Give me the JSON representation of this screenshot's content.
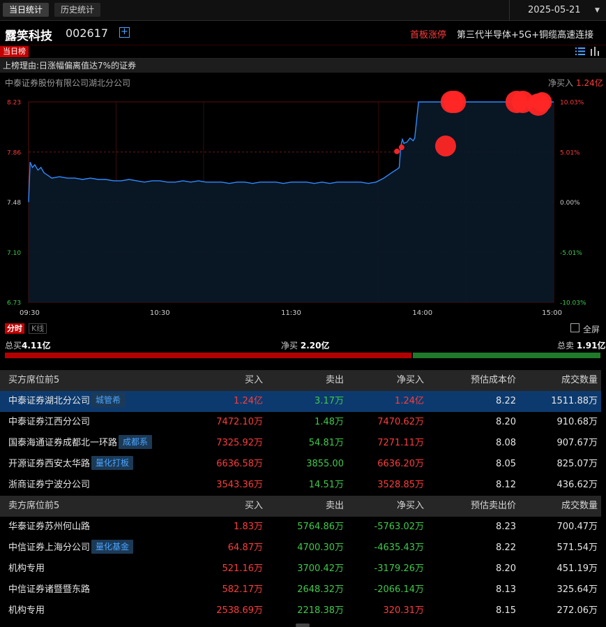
{
  "tabs": {
    "today": "当日统计",
    "history": "历史统计"
  },
  "date": "2025-05-21",
  "stock": {
    "name": "露笑科技",
    "code": "002617",
    "add_symbol": "+",
    "first_limit": "首板涨停",
    "concept": "第三代半导体+5G+铜缆高速连接"
  },
  "list": {
    "badge": "当日榜",
    "reason": "上榜理由:日涨幅偏离值达7%的证券",
    "broker": "中泰证券股份有限公司湖北分公司",
    "net_buy_label": "净买入",
    "net_buy_value": "1.24亿"
  },
  "chart_data": {
    "type": "line",
    "y_left_ticks": [
      "8.23",
      "7.86",
      "7.48",
      "7.10",
      "6.73"
    ],
    "y_right_ticks": [
      "10.03%",
      "5.01%",
      "0.00%",
      "-5.01%",
      "-10.03%"
    ],
    "x_ticks": [
      "09:30",
      "10:30",
      "11:30",
      "14:00",
      "15:00"
    ],
    "ylim": [
      6.73,
      8.23
    ],
    "prev_close": 7.48,
    "x_minutes": [
      0,
      2,
      5,
      8,
      12,
      16,
      20,
      25,
      30,
      40,
      50,
      60,
      70,
      80,
      90,
      100,
      110,
      120,
      130,
      140,
      150,
      160,
      170,
      180,
      190,
      200,
      210,
      220,
      230,
      240,
      250,
      260,
      270,
      280,
      290,
      300,
      310,
      320,
      330,
      340,
      350,
      360,
      370,
      380,
      390,
      400,
      410,
      420,
      430,
      440,
      450,
      460,
      470,
      478,
      480,
      482,
      484,
      486,
      490,
      494,
      498,
      500,
      505,
      510,
      520,
      530,
      540,
      550,
      560,
      570,
      580,
      590,
      600,
      610,
      620,
      630,
      640,
      650,
      660,
      670,
      680
    ],
    "price": [
      7.48,
      7.78,
      7.74,
      7.76,
      7.72,
      7.74,
      7.7,
      7.68,
      7.66,
      7.67,
      7.66,
      7.66,
      7.65,
      7.66,
      7.65,
      7.65,
      7.64,
      7.64,
      7.65,
      7.64,
      7.63,
      7.64,
      7.64,
      7.63,
      7.63,
      7.64,
      7.63,
      7.64,
      7.63,
      7.63,
      7.63,
      7.62,
      7.63,
      7.63,
      7.62,
      7.63,
      7.63,
      7.63,
      7.62,
      7.63,
      7.63,
      7.63,
      7.62,
      7.63,
      7.62,
      7.63,
      7.63,
      7.63,
      7.63,
      7.62,
      7.63,
      7.66,
      7.7,
      7.73,
      7.74,
      7.9,
      7.95,
      7.92,
      7.93,
      7.96,
      7.94,
      7.96,
      8.23,
      8.23,
      8.23,
      8.23,
      8.23,
      8.23,
      8.23,
      8.23,
      8.23,
      8.23,
      8.23,
      8.23,
      8.23,
      8.23,
      8.23,
      8.23,
      8.23,
      8.23,
      8.23
    ],
    "markers": [
      {
        "t": 477,
        "p": 7.86,
        "r": 4
      },
      {
        "t": 483,
        "p": 7.89,
        "r": 4
      },
      {
        "t": 540,
        "p": 7.9,
        "r": 15
      },
      {
        "t": 548,
        "p": 8.23,
        "r": 16
      },
      {
        "t": 552,
        "p": 8.23,
        "r": 16
      },
      {
        "t": 632,
        "p": 8.23,
        "r": 16
      },
      {
        "t": 640,
        "p": 8.23,
        "r": 16
      },
      {
        "t": 660,
        "p": 8.21,
        "r": 16
      },
      {
        "t": 665,
        "p": 8.23,
        "r": 14
      }
    ],
    "line_color": "#2f8bff",
    "marker_color": "#ff2626"
  },
  "controls": {
    "fenshi": "分时",
    "kline": "K线",
    "fullscreen": "全屏"
  },
  "totals": {
    "buy_label": "总买",
    "buy_value": "4.11亿",
    "net_label": "净买",
    "net_value": "2.20亿",
    "sell_label": "总卖",
    "sell_value": "1.91亿",
    "buy_ratio": 0.683
  },
  "buy_table": {
    "headers": [
      "买方席位前5",
      "买入",
      "卖出",
      "净买入",
      "预估成本价",
      "成交数量"
    ],
    "rows": [
      {
        "name": "中泰证券湖北分公司",
        "tag": "城管希",
        "buy": "1.24亿",
        "sell": "3.17万",
        "net": "1.24亿",
        "net_color": "red",
        "price": "8.22",
        "volume": "1511.88万"
      },
      {
        "name": "中泰证券江西分公司",
        "tag": "",
        "buy": "7472.10万",
        "sell": "1.48万",
        "net": "7470.62万",
        "net_color": "red",
        "price": "8.20",
        "volume": "910.68万"
      },
      {
        "name": "国泰海通证券成都北一环路",
        "tag": "成都系",
        "buy": "7325.92万",
        "sell": "54.81万",
        "net": "7271.11万",
        "net_color": "red",
        "price": "8.08",
        "volume": "907.67万"
      },
      {
        "name": "开源证券西安太华路",
        "tag": "量化打板",
        "buy": "6636.58万",
        "sell": "3855.00",
        "net": "6636.20万",
        "net_color": "red",
        "price": "8.05",
        "volume": "825.07万"
      },
      {
        "name": "浙商证券宁波分公司",
        "tag": "",
        "buy": "3543.36万",
        "sell": "14.51万",
        "net": "3528.85万",
        "net_color": "red",
        "price": "8.12",
        "volume": "436.62万"
      }
    ]
  },
  "sell_table": {
    "headers": [
      "卖方席位前5",
      "买入",
      "卖出",
      "净买入",
      "预估卖出价",
      "成交数量"
    ],
    "rows": [
      {
        "name": "华泰证券苏州何山路",
        "tag": "",
        "buy": "1.83万",
        "sell": "5764.86万",
        "net": "-5763.02万",
        "net_color": "green",
        "price": "8.23",
        "volume": "700.47万"
      },
      {
        "name": "中信证券上海分公司",
        "tag": "量化基金",
        "buy": "64.87万",
        "sell": "4700.30万",
        "net": "-4635.43万",
        "net_color": "green",
        "price": "8.22",
        "volume": "571.54万"
      },
      {
        "name": "机构专用",
        "tag": "",
        "buy": "521.16万",
        "sell": "3700.42万",
        "net": "-3179.26万",
        "net_color": "green",
        "price": "8.20",
        "volume": "451.19万"
      },
      {
        "name": "中信证券诸暨暨东路",
        "tag": "",
        "buy": "582.17万",
        "sell": "2648.32万",
        "net": "-2066.14万",
        "net_color": "green",
        "price": "8.13",
        "volume": "325.64万"
      },
      {
        "name": "机构专用",
        "tag": "",
        "buy": "2538.69万",
        "sell": "2218.38万",
        "net": "320.31万",
        "net_color": "red",
        "price": "8.15",
        "volume": "272.06万"
      }
    ]
  }
}
